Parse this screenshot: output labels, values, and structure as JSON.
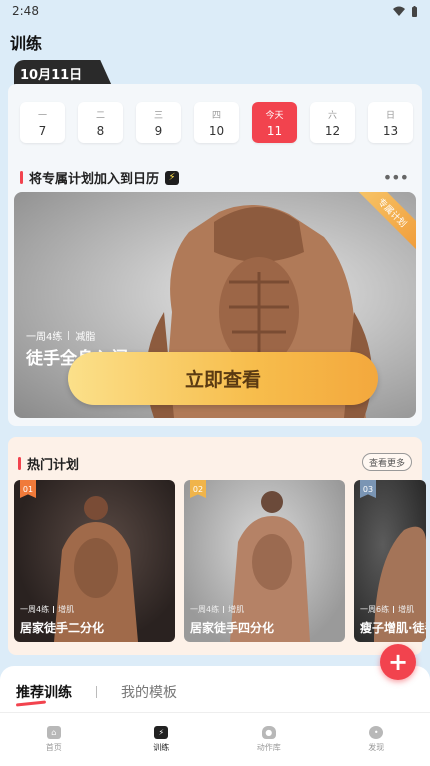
{
  "status_bar": {
    "time": "2:48"
  },
  "page_title": "训练",
  "date_tab": "10月11日",
  "week": [
    {
      "weekday": "一",
      "day": "7",
      "today": false
    },
    {
      "weekday": "二",
      "day": "8",
      "today": false
    },
    {
      "weekday": "三",
      "day": "9",
      "today": false
    },
    {
      "weekday": "四",
      "day": "10",
      "today": false
    },
    {
      "weekday": "今天",
      "day": "11",
      "today": true
    },
    {
      "weekday": "六",
      "day": "12",
      "today": false
    },
    {
      "weekday": "日",
      "day": "13",
      "today": false
    }
  ],
  "calendar_section": {
    "title": "将专属计划加入到日历"
  },
  "hero": {
    "ribbon": "专属计划",
    "freq": "一周4练",
    "goal": "减脂",
    "title": "徒手全身入门",
    "cta": "立即查看"
  },
  "hot_plans": {
    "title": "热门计划",
    "see_more": "查看更多",
    "items": [
      {
        "rank": "01",
        "freq": "一周4练",
        "goal": "增肌",
        "name": "居家徒手二分化",
        "badge_color": "#f07a3a"
      },
      {
        "rank": "02",
        "freq": "一周4练",
        "goal": "增肌",
        "name": "居家徒手四分化",
        "badge_color": "#f0b44a"
      },
      {
        "rank": "03",
        "freq": "一周6练",
        "goal": "增肌",
        "name": "瘦子增肌·徒手",
        "badge_color": "#7a95b4"
      }
    ]
  },
  "recommend_tabs": {
    "active": "推荐训练",
    "inactive": "我的模板"
  },
  "fab_icon": "plus-icon",
  "tabbar": [
    {
      "label": "首页",
      "icon": "home-icon",
      "active": false
    },
    {
      "label": "训练",
      "icon": "bolt-icon",
      "active": true
    },
    {
      "label": "动作库",
      "icon": "kettlebell-icon",
      "active": false
    },
    {
      "label": "发现",
      "icon": "discover-icon",
      "active": false
    }
  ],
  "colors": {
    "accent": "#f2434e",
    "cta": "#f7bd4c"
  }
}
